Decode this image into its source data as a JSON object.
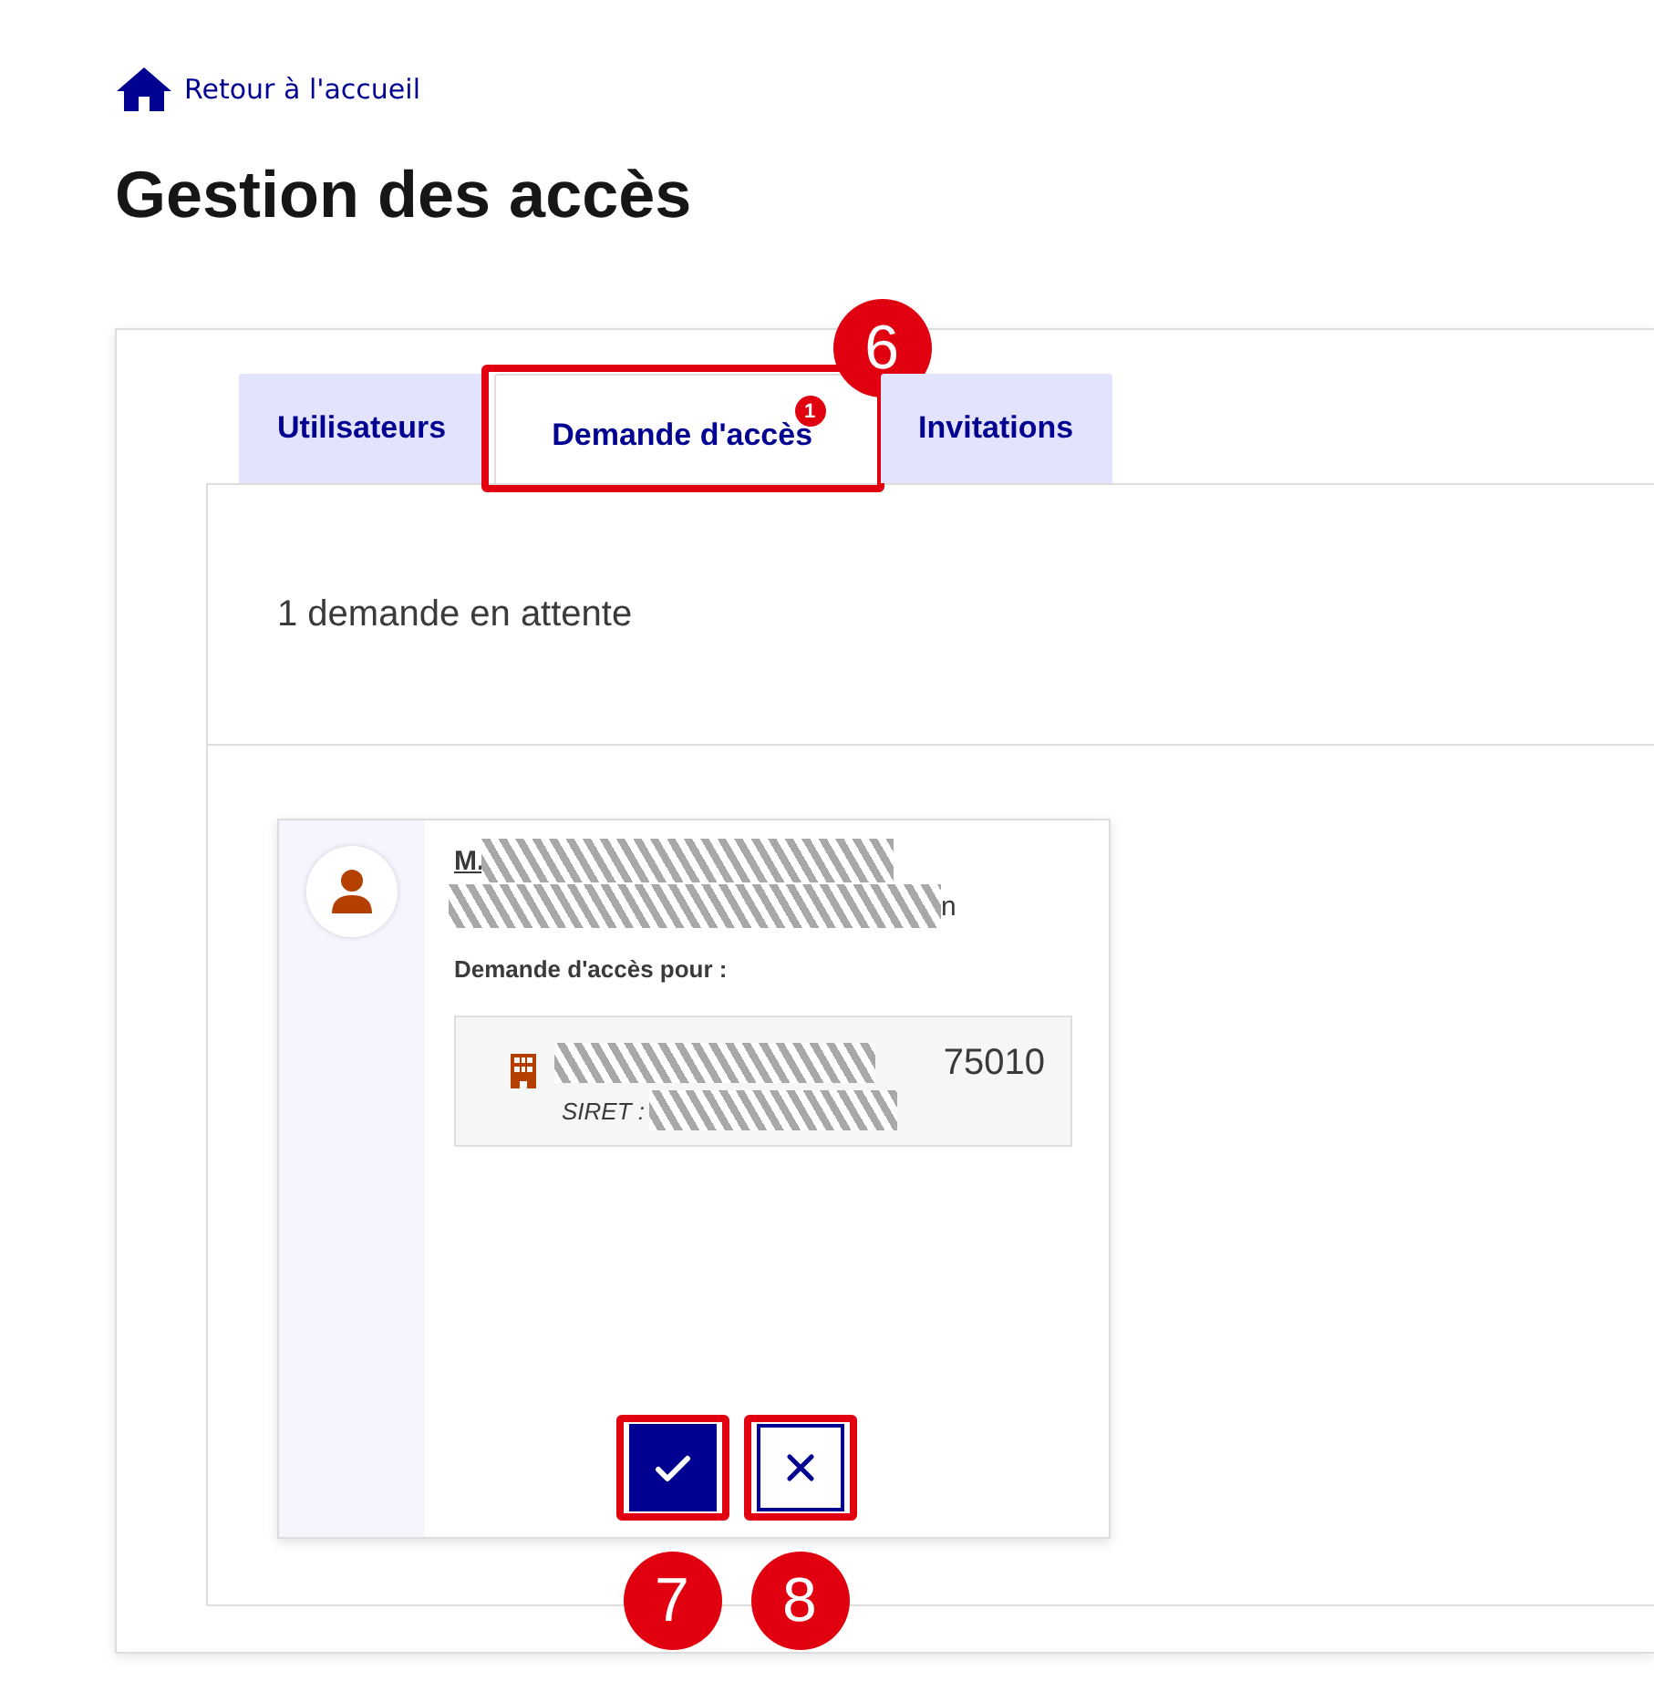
{
  "back_link": {
    "label": "Retour à l'accueil"
  },
  "title": "Gestion des accès",
  "tabs": [
    {
      "label": "Utilisateurs",
      "selected": false
    },
    {
      "label": "Demande d'accès",
      "selected": true,
      "badge": "1",
      "callout": "6"
    },
    {
      "label": "Invitations",
      "selected": false
    }
  ],
  "pending_count": "1 demande en attente",
  "request": {
    "name": "M.",
    "email_tail": "n",
    "access_label": "Demande d'accès pour :",
    "establishment": {
      "postcode": "75010",
      "siret_label": "SIRET :"
    },
    "actions": [
      {
        "kind": "approve",
        "callout": "7"
      },
      {
        "kind": "reject",
        "callout": "8"
      }
    ]
  }
}
